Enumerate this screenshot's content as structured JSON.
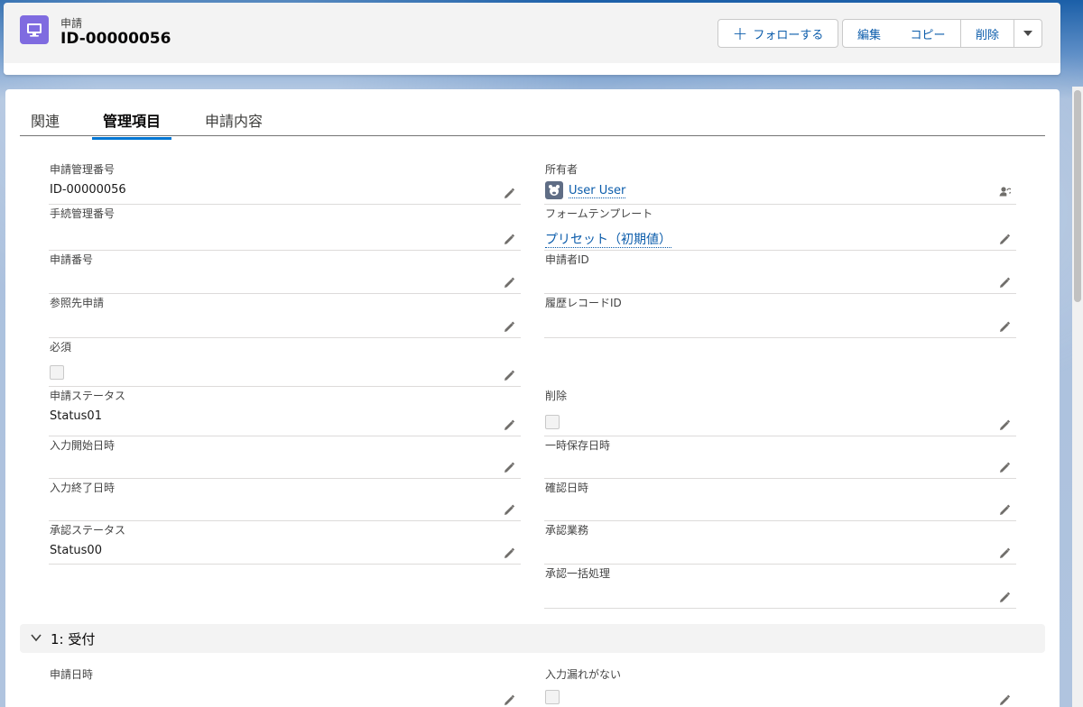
{
  "header": {
    "object_label": "申請",
    "record_title": "ID-00000056",
    "follow_label": "フォローする",
    "edit_label": "編集",
    "copy_label": "コピー",
    "delete_label": "削除"
  },
  "tabs": [
    {
      "label": "関連"
    },
    {
      "label": "管理項目"
    },
    {
      "label": "申請内容"
    }
  ],
  "fields": {
    "left": [
      {
        "label": "申請管理番号",
        "value": "ID-00000056"
      },
      {
        "label": "手続管理番号",
        "value": ""
      },
      {
        "label": "申請番号",
        "value": ""
      },
      {
        "label": "参照先申請",
        "value": ""
      },
      {
        "label": "必須",
        "value": ""
      },
      {
        "label": "申請ステータス",
        "value": "Status01"
      },
      {
        "label": "入力開始日時",
        "value": ""
      },
      {
        "label": "入力終了日時",
        "value": ""
      },
      {
        "label": "承認ステータス",
        "value": "Status00"
      }
    ],
    "right": [
      {
        "label": "所有者",
        "value": "User User"
      },
      {
        "label": "フォームテンプレート",
        "value": "プリセット（初期値）"
      },
      {
        "label": "申請者ID",
        "value": ""
      },
      {
        "label": "履歴レコードID",
        "value": ""
      },
      {
        "label": "削除",
        "value": ""
      },
      {
        "label": "一時保存日時",
        "value": ""
      },
      {
        "label": "確認日時",
        "value": ""
      },
      {
        "label": "承認業務",
        "value": ""
      },
      {
        "label": "承認一括処理",
        "value": ""
      }
    ]
  },
  "section": {
    "title": "1: 受付",
    "fields": [
      {
        "label": "申請日時",
        "value": ""
      },
      {
        "label": "入力漏れがない",
        "value": ""
      }
    ]
  },
  "colors": {
    "brand": "#0176d3",
    "object_icon": "#7f6be0"
  },
  "icons": [
    "desktop-icon",
    "add-icon",
    "chevron-down-icon",
    "pencil-icon",
    "change-owner-icon",
    "avatar-icon"
  ]
}
